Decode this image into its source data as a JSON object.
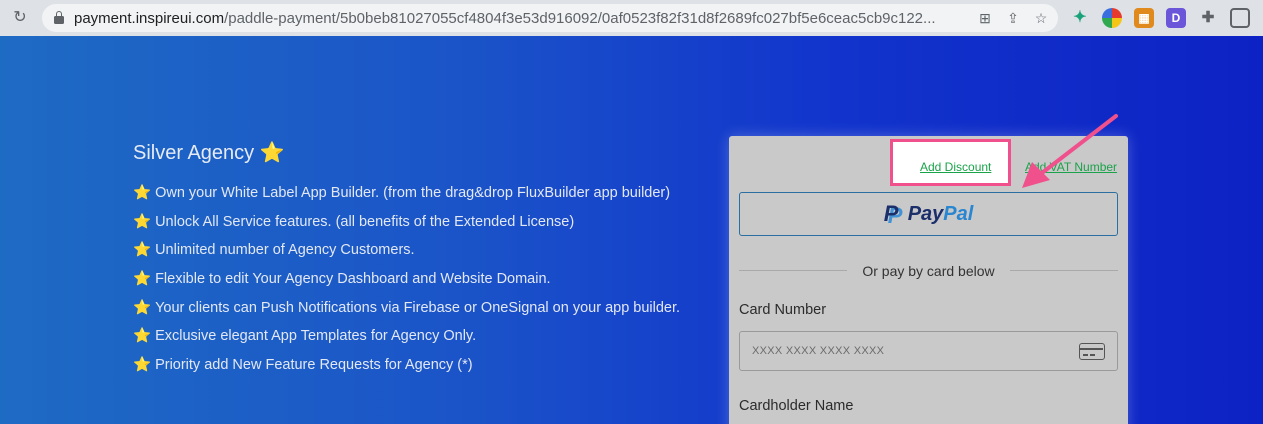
{
  "browser": {
    "url_host": "payment.inspireui.com",
    "url_path": "/paddle-payment/5b0beb81027055cf4804f3e53d916092/0af0523f82f31d8f2689fc027bf5e6ceac5cb9c122..."
  },
  "plan": {
    "title": "Silver Agency",
    "title_star": "⭐",
    "features": [
      "Own your White Label App Builder. (from the drag&drop FluxBuilder app builder)",
      "Unlock All Service features. (all benefits of the Extended License)",
      "Unlimited number of Agency Customers.",
      "Flexible to edit Your Agency Dashboard and Website Domain.",
      "Your clients can Push Notifications via Firebase or OneSignal on your app builder.",
      "Exclusive elegant App Templates for Agency Only.",
      "Priority add New Feature Requests for Agency (*)"
    ],
    "feature_star": "⭐"
  },
  "checkout": {
    "add_discount": "Add Discount",
    "add_vat": "Add VAT Number",
    "paypal_pay": "Pay",
    "paypal_pal": "Pal",
    "divider_text": "Or pay by card below",
    "card_number_label": "Card Number",
    "card_number_placeholder": "XXXX XXXX XXXX XXXX",
    "cardholder_label": "Cardholder Name"
  },
  "colors": {
    "highlight": "#f0508c",
    "link": "#1aa34a",
    "paypal_dark": "#1b2f6b",
    "paypal_light": "#2a86d1"
  }
}
